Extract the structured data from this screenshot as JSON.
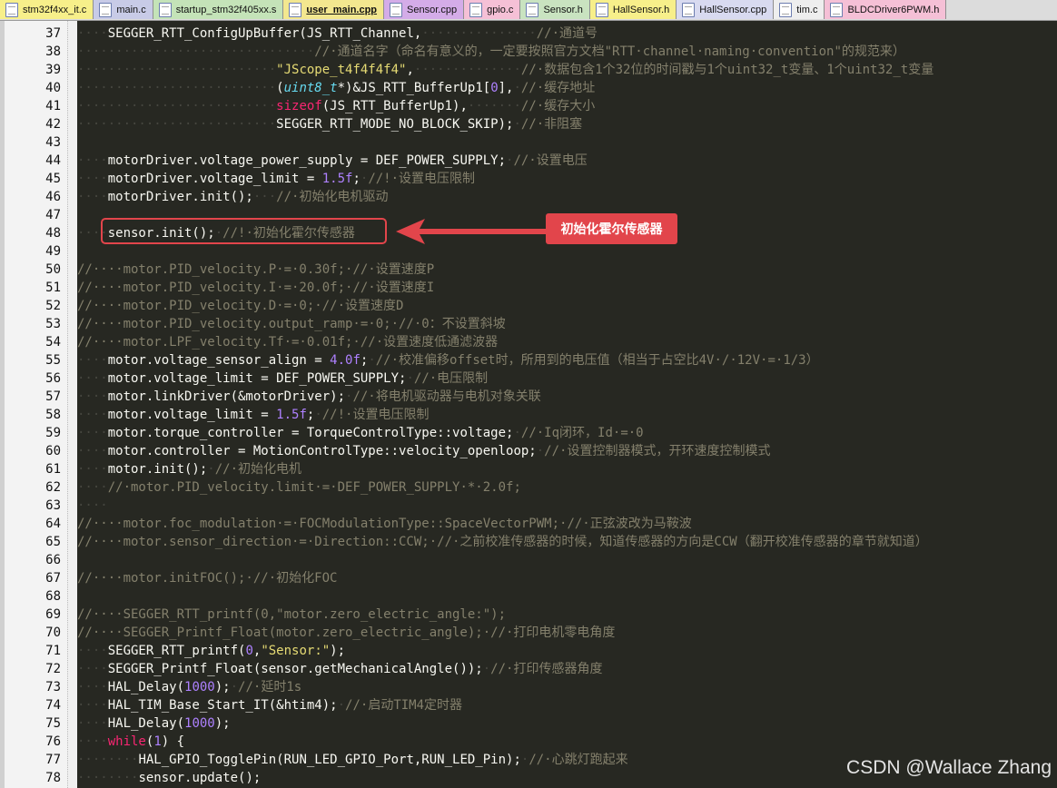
{
  "tabs": [
    {
      "label": "stm32f4xx_it.c",
      "color": "#f7ef8a",
      "active": false
    },
    {
      "label": "main.c",
      "color": "#c8cbe7",
      "active": false
    },
    {
      "label": "startup_stm32f405xx.s",
      "color": "#c4e3b8",
      "active": false
    },
    {
      "label": "user_main.cpp",
      "color": "#f3e78f",
      "active": true
    },
    {
      "label": "Sensor.cpp",
      "color": "#d4ace8",
      "active": false
    },
    {
      "label": "gpio.c",
      "color": "#f5c0d6",
      "active": false
    },
    {
      "label": "Sensor.h",
      "color": "#c9e3c0",
      "active": false
    },
    {
      "label": "HallSensor.h",
      "color": "#f7ef8a",
      "active": false
    },
    {
      "label": "HallSensor.cpp",
      "color": "#d8daf0",
      "active": false
    },
    {
      "label": "tim.c",
      "color": "#eeeeee",
      "active": false
    },
    {
      "label": "BLDCDriver6PWM.h",
      "color": "#f5c0d6",
      "active": false
    }
  ],
  "code_lines": [
    {
      "n": "37",
      "tokens": [
        [
          "ws",
          "····"
        ],
        [
          "code",
          "SEGGER_RTT_ConfigUpBuffer(JS_RTT_Channel,"
        ],
        [
          "ws",
          "···············"
        ],
        [
          "comment",
          "//·通道号"
        ]
      ]
    },
    {
      "n": "38",
      "tokens": [
        [
          "ws",
          "·······························"
        ],
        [
          "comment",
          "//·通道名字（命名有意义的，一定要按照官方文档\"RTT·channel·naming·convention\"的规范来）"
        ]
      ]
    },
    {
      "n": "39",
      "tokens": [
        [
          "ws",
          "··························"
        ],
        [
          "string",
          "\"JScope_t4f4f4f4\""
        ],
        [
          "code",
          ","
        ],
        [
          "ws",
          "··············"
        ],
        [
          "comment",
          "//·数据包含1个32位的时间戳与1个uint32_t变量、1个uint32_t变量"
        ]
      ]
    },
    {
      "n": "40",
      "tokens": [
        [
          "ws",
          "··························"
        ],
        [
          "code",
          "("
        ],
        [
          "type",
          "uint8_t"
        ],
        [
          "code",
          "*)&JS_RTT_BufferUp1["
        ],
        [
          "number",
          "0"
        ],
        [
          "code",
          "],"
        ],
        [
          "ws",
          "·"
        ],
        [
          "comment",
          "//·缓存地址"
        ]
      ]
    },
    {
      "n": "41",
      "tokens": [
        [
          "ws",
          "··························"
        ],
        [
          "keyword",
          "sizeof"
        ],
        [
          "code",
          "(JS_RTT_BufferUp1),"
        ],
        [
          "ws",
          "·······"
        ],
        [
          "comment",
          "//·缓存大小"
        ]
      ]
    },
    {
      "n": "42",
      "tokens": [
        [
          "ws",
          "··························"
        ],
        [
          "code",
          "SEGGER_RTT_MODE_NO_BLOCK_SKIP);"
        ],
        [
          "ws",
          "·"
        ],
        [
          "comment",
          "//·非阻塞"
        ]
      ]
    },
    {
      "n": "43",
      "tokens": []
    },
    {
      "n": "44",
      "tokens": [
        [
          "ws",
          "····"
        ],
        [
          "code",
          "motorDriver.voltage_power_supply = DEF_POWER_SUPPLY;"
        ],
        [
          "ws",
          "·"
        ],
        [
          "comment",
          "//·设置电压"
        ]
      ]
    },
    {
      "n": "45",
      "tokens": [
        [
          "ws",
          "····"
        ],
        [
          "code",
          "motorDriver.voltage_limit = "
        ],
        [
          "number",
          "1.5f"
        ],
        [
          "code",
          ";"
        ],
        [
          "ws",
          "·"
        ],
        [
          "comment",
          "//!·设置电压限制"
        ]
      ]
    },
    {
      "n": "46",
      "tokens": [
        [
          "ws",
          "····"
        ],
        [
          "code",
          "motorDriver.init();"
        ],
        [
          "ws",
          "···"
        ],
        [
          "comment",
          "//·初始化电机驱动"
        ]
      ]
    },
    {
      "n": "47",
      "tokens": []
    },
    {
      "n": "48",
      "tokens": [
        [
          "ws",
          "····"
        ],
        [
          "code",
          "sensor.init();"
        ],
        [
          "ws",
          "·"
        ],
        [
          "comment",
          "//!·初始化霍尔传感器"
        ]
      ]
    },
    {
      "n": "49",
      "tokens": []
    },
    {
      "n": "50",
      "tokens": [
        [
          "comment",
          "//····motor.PID_velocity.P·=·0.30f;·//·设置速度P"
        ]
      ]
    },
    {
      "n": "51",
      "tokens": [
        [
          "comment",
          "//····motor.PID_velocity.I·=·20.0f;·//·设置速度I"
        ]
      ]
    },
    {
      "n": "52",
      "tokens": [
        [
          "comment",
          "//····motor.PID_velocity.D·=·0;·//·设置速度D"
        ]
      ]
    },
    {
      "n": "53",
      "tokens": [
        [
          "comment",
          "//····motor.PID_velocity.output_ramp·=·0;·//·0：不设置斜坡"
        ]
      ]
    },
    {
      "n": "54",
      "tokens": [
        [
          "comment",
          "//····motor.LPF_velocity.Tf·=·0.01f;·//·设置速度低通滤波器"
        ]
      ]
    },
    {
      "n": "55",
      "tokens": [
        [
          "ws",
          "····"
        ],
        [
          "code",
          "motor.voltage_sensor_align = "
        ],
        [
          "number",
          "4.0f"
        ],
        [
          "code",
          ";"
        ],
        [
          "ws",
          "·"
        ],
        [
          "comment",
          "//·校准偏移offset时，所用到的电压值（相当于占空比4V·/·12V·=·1/3）"
        ]
      ]
    },
    {
      "n": "56",
      "tokens": [
        [
          "ws",
          "····"
        ],
        [
          "code",
          "motor.voltage_limit = DEF_POWER_SUPPLY;"
        ],
        [
          "ws",
          "·"
        ],
        [
          "comment",
          "//·电压限制"
        ]
      ]
    },
    {
      "n": "57",
      "tokens": [
        [
          "ws",
          "····"
        ],
        [
          "code",
          "motor.linkDriver(&motorDriver);"
        ],
        [
          "ws",
          "·"
        ],
        [
          "comment",
          "//·将电机驱动器与电机对象关联"
        ]
      ]
    },
    {
      "n": "58",
      "tokens": [
        [
          "ws",
          "····"
        ],
        [
          "code",
          "motor.voltage_limit = "
        ],
        [
          "number",
          "1.5f"
        ],
        [
          "code",
          ";"
        ],
        [
          "ws",
          "·"
        ],
        [
          "comment",
          "//!·设置电压限制"
        ]
      ]
    },
    {
      "n": "59",
      "tokens": [
        [
          "ws",
          "····"
        ],
        [
          "code",
          "motor.torque_controller = TorqueControlType::voltage;"
        ],
        [
          "ws",
          "·"
        ],
        [
          "comment",
          "//·Iq闭环，Id·=·0"
        ]
      ]
    },
    {
      "n": "60",
      "tokens": [
        [
          "ws",
          "····"
        ],
        [
          "code",
          "motor.controller = MotionControlType::velocity_openloop;"
        ],
        [
          "ws",
          "·"
        ],
        [
          "comment",
          "//·设置控制器模式，开环速度控制模式"
        ]
      ]
    },
    {
      "n": "61",
      "tokens": [
        [
          "ws",
          "····"
        ],
        [
          "code",
          "motor.init();"
        ],
        [
          "ws",
          "·"
        ],
        [
          "comment",
          "//·初始化电机"
        ]
      ]
    },
    {
      "n": "62",
      "tokens": [
        [
          "ws",
          "····"
        ],
        [
          "comment",
          "//·motor.PID_velocity.limit·=·DEF_POWER_SUPPLY·*·2.0f;"
        ]
      ]
    },
    {
      "n": "63",
      "tokens": [
        [
          "ws",
          "····"
        ]
      ]
    },
    {
      "n": "64",
      "tokens": [
        [
          "comment",
          "//····motor.foc_modulation·=·FOCModulationType::SpaceVectorPWM;·//·正弦波改为马鞍波"
        ]
      ]
    },
    {
      "n": "65",
      "tokens": [
        [
          "comment",
          "//····motor.sensor_direction·=·Direction::CCW;·//·之前校准传感器的时候，知道传感器的方向是CCW（翻开校准传感器的章节就知道）"
        ]
      ]
    },
    {
      "n": "66",
      "tokens": []
    },
    {
      "n": "67",
      "tokens": [
        [
          "comment",
          "//····motor.initFOC();·//·初始化FOC"
        ]
      ]
    },
    {
      "n": "68",
      "tokens": []
    },
    {
      "n": "69",
      "tokens": [
        [
          "comment",
          "//····SEGGER_RTT_printf(0,\"motor.zero_electric_angle:\");"
        ]
      ]
    },
    {
      "n": "70",
      "tokens": [
        [
          "comment",
          "//····SEGGER_Printf_Float(motor.zero_electric_angle);·//·打印电机零电角度"
        ]
      ]
    },
    {
      "n": "71",
      "tokens": [
        [
          "ws",
          "····"
        ],
        [
          "code",
          "SEGGER_RTT_printf("
        ],
        [
          "number",
          "0"
        ],
        [
          "code",
          ","
        ],
        [
          "string",
          "\"Sensor:\""
        ],
        [
          "code",
          ");"
        ]
      ]
    },
    {
      "n": "72",
      "tokens": [
        [
          "ws",
          "····"
        ],
        [
          "code",
          "SEGGER_Printf_Float(sensor.getMechanicalAngle());"
        ],
        [
          "ws",
          "·"
        ],
        [
          "comment",
          "//·打印传感器角度"
        ]
      ]
    },
    {
      "n": "73",
      "tokens": [
        [
          "ws",
          "····"
        ],
        [
          "code",
          "HAL_Delay("
        ],
        [
          "number",
          "1000"
        ],
        [
          "code",
          ");"
        ],
        [
          "ws",
          "·"
        ],
        [
          "comment",
          "//·延时1s"
        ]
      ]
    },
    {
      "n": "74",
      "tokens": [
        [
          "ws",
          "····"
        ],
        [
          "code",
          "HAL_TIM_Base_Start_IT(&htim4);"
        ],
        [
          "ws",
          "·"
        ],
        [
          "comment",
          "//·启动TIM4定时器"
        ]
      ]
    },
    {
      "n": "75",
      "tokens": [
        [
          "ws",
          "····"
        ],
        [
          "code",
          "HAL_Delay("
        ],
        [
          "number",
          "1000"
        ],
        [
          "code",
          ");"
        ]
      ]
    },
    {
      "n": "76",
      "tokens": [
        [
          "ws",
          "····"
        ],
        [
          "keyword",
          "while"
        ],
        [
          "code",
          "("
        ],
        [
          "number",
          "1"
        ],
        [
          "code",
          ") {"
        ]
      ]
    },
    {
      "n": "77",
      "tokens": [
        [
          "ws",
          "········"
        ],
        [
          "code",
          "HAL_GPIO_TogglePin(RUN_LED_GPIO_Port,RUN_LED_Pin);"
        ],
        [
          "ws",
          "·"
        ],
        [
          "comment",
          "//·心跳灯跑起来"
        ]
      ]
    },
    {
      "n": "78",
      "tokens": [
        [
          "ws",
          "········"
        ],
        [
          "code",
          "sensor.update();"
        ]
      ]
    }
  ],
  "annotation": {
    "callout_text": "初始化霍尔传感器",
    "box_color": "#e2454b"
  },
  "watermark": "CSDN @Wallace Zhang"
}
